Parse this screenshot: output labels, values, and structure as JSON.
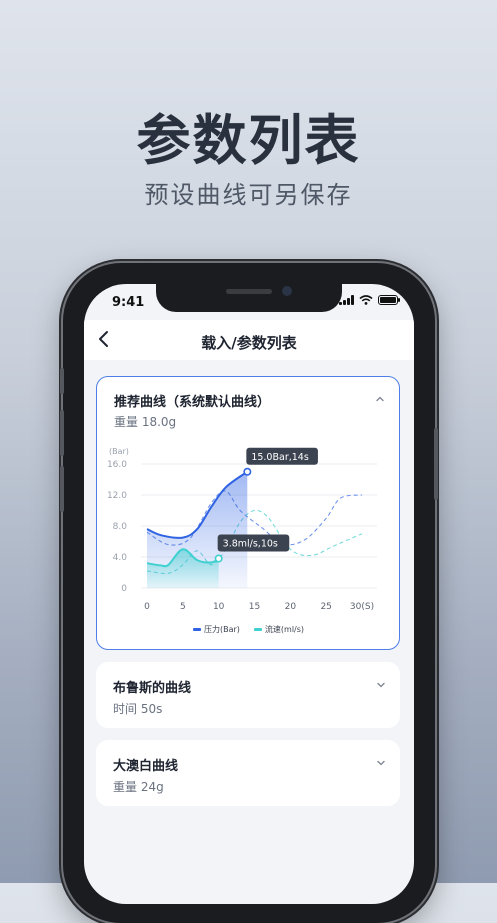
{
  "hero": {
    "title": "参数列表",
    "subtitle": "预设曲线可另保存"
  },
  "status_bar": {
    "time": "9:41",
    "icons": [
      "signal-icon",
      "wifi-icon",
      "battery-icon"
    ]
  },
  "navbar": {
    "back_icon": "chevron-left-icon",
    "title": "载入/参数列表"
  },
  "cards": [
    {
      "title": "推荐曲线（系统默认曲线）",
      "subtitle": "重量 18.0g",
      "expanded": true,
      "chevron": "chevron-up-icon"
    },
    {
      "title": "布鲁斯的曲线",
      "subtitle": "时间 50s",
      "expanded": false,
      "chevron": "chevron-down-icon"
    },
    {
      "title": "大澳白曲线",
      "subtitle": "重量 24g",
      "expanded": false,
      "chevron": "chevron-down-icon"
    }
  ],
  "colors": {
    "accent": "#3f6fe0",
    "pressure": "#2f63e3",
    "flow": "#3fd0cf",
    "tooltip_bg": "#3c4350"
  },
  "chart_data": {
    "type": "line",
    "y_unit": "(Bar)",
    "x_unit": "(S)",
    "y_ticks": [
      "16.0",
      "12.0",
      "8.0",
      "4.0",
      "0"
    ],
    "x_ticks": [
      "0",
      "5",
      "10",
      "15",
      "20",
      "25",
      "30"
    ],
    "ylim": [
      0,
      16
    ],
    "xlim": [
      0,
      30
    ],
    "grid": true,
    "legend_position": "bottom-center",
    "series": [
      {
        "name": "压力(Bar)",
        "style": "solid-filled",
        "points": [
          [
            0,
            7.6
          ],
          [
            2,
            6.8
          ],
          [
            5,
            6.5
          ],
          [
            7,
            7.6
          ],
          [
            9,
            10.5
          ],
          [
            11,
            13.0
          ],
          [
            14,
            15.0
          ]
        ]
      },
      {
        "name": "流速(ml/s)",
        "style": "solid-filled",
        "points": [
          [
            0,
            3.2
          ],
          [
            2,
            2.9
          ],
          [
            3,
            3.0
          ],
          [
            5,
            5.0
          ],
          [
            7,
            3.6
          ],
          [
            9,
            3.3
          ],
          [
            10,
            3.8
          ]
        ]
      },
      {
        "name": "压力(Bar)",
        "style": "dashed-preset",
        "points": [
          [
            0,
            7.2
          ],
          [
            3,
            5.6
          ],
          [
            6,
            6.4
          ],
          [
            9,
            11.0
          ],
          [
            11,
            12.5
          ],
          [
            13,
            10.0
          ],
          [
            16,
            7.8
          ],
          [
            19,
            5.7
          ],
          [
            22,
            6.2
          ],
          [
            25,
            9.0
          ],
          [
            27,
            11.6
          ],
          [
            30,
            12.0
          ]
        ]
      },
      {
        "name": "流速(ml/s)",
        "style": "dashed-preset",
        "points": [
          [
            0,
            2.2
          ],
          [
            3,
            1.9
          ],
          [
            5,
            3.0
          ],
          [
            7,
            4.8
          ],
          [
            9,
            3.0
          ],
          [
            11,
            5.0
          ],
          [
            13,
            8.5
          ],
          [
            15,
            10.0
          ],
          [
            17,
            9.0
          ],
          [
            20,
            5.0
          ],
          [
            23,
            4.2
          ],
          [
            26,
            5.4
          ],
          [
            30,
            7.0
          ]
        ]
      }
    ],
    "annotations": [
      {
        "label": "15.0Bar,14s",
        "x": 14,
        "y": 15.0,
        "series": "压力(Bar)"
      },
      {
        "label": "3.8ml/s,10s",
        "x": 10,
        "y": 3.8,
        "series": "流速(ml/s)"
      }
    ]
  }
}
